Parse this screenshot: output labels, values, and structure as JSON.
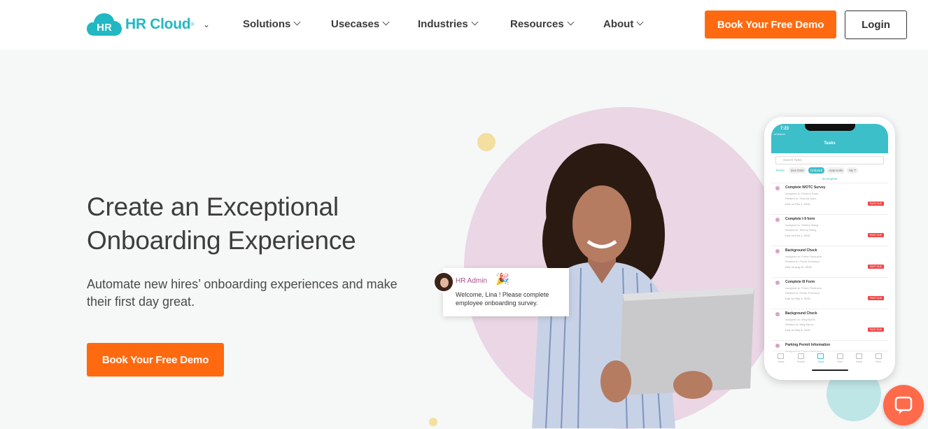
{
  "nav": {
    "logo_badge": "HR",
    "logo_text": "HR Cloud",
    "logo_mark": "®",
    "items": [
      {
        "label": "Solutions"
      },
      {
        "label": "Usecases"
      },
      {
        "label": "Industries"
      },
      {
        "label": "Resources"
      },
      {
        "label": "About"
      }
    ],
    "demo_button": "Book Your Free Demo",
    "login_button": "Login"
  },
  "hero": {
    "title": "Create an Exceptional Onboarding Experience",
    "subtitle": "Automate new hires’ onboarding experiences and make their first day great.",
    "cta": "Book Your Free Demo"
  },
  "toast": {
    "name": "HR Admin",
    "message": "Welcome, Lina ! Please complete employee onboarding survey."
  },
  "phone": {
    "time": "7:23",
    "back": "◂ Search",
    "title": "Tasks",
    "search_placeholder": "Search Tasks",
    "filters": [
      "Reset",
      "Due Date",
      "Onboard",
      "Approvals",
      "My T"
    ],
    "status": "Incomplete",
    "tasks": [
      {
        "title": "Complete WOTC Survey",
        "assigned": "Assigned to: Krishna Stars",
        "related": "Related to: Krishna Stars",
        "due": "Due on Feb 1, 2015",
        "badge": "PAST DUE"
      },
      {
        "title": "Complete I-9 form",
        "assigned": "Assigned to: Selena Wang",
        "related": "Related to: Selena Wang",
        "due": "Due on Feb 1, 2015",
        "badge": "PAST DUE"
      },
      {
        "title": "Background Check",
        "assigned": "Assigned to: Porter Robinson",
        "related": "Related to: Porter Robinson",
        "due": "Due on Aug 29, 2015",
        "badge": "PAST DUE"
      },
      {
        "title": "Complete I9 Form",
        "assigned": "Assigned to: Porter Robinson",
        "related": "Related to: Porter Robinson",
        "due": "Due on Sep 3, 2015",
        "badge": "PAST DUE"
      },
      {
        "title": "Background Check",
        "assigned": "Assigned to: Meg Myers",
        "related": "Related to: Meg Myers",
        "due": "Due on Sep 8, 2015",
        "badge": "PAST DUE"
      },
      {
        "title": "Parking Permit Information",
        "assigned": "Assigned to: Porter Robinson",
        "related": "",
        "due": "",
        "badge": ""
      }
    ],
    "tabs": [
      "Home",
      "People",
      "Tasks",
      "Feed",
      "Inbox",
      "More"
    ]
  },
  "colors": {
    "accent_orange": "#ff6a10",
    "brand_teal": "#1fb8c3",
    "circle_pink": "#ead6e4"
  }
}
